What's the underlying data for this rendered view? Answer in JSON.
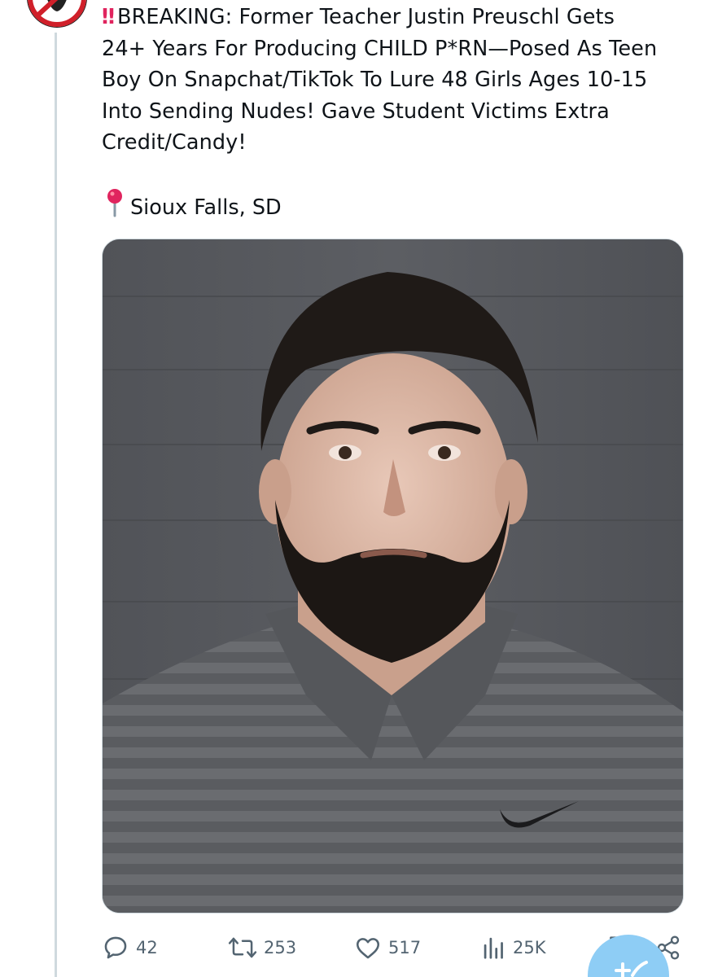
{
  "tweet": {
    "text_lines": [
      "BREAKING: Former Teacher Justin Preuschl Gets",
      "24+ Years For Producing CHILD P*RN—Posed As Teen",
      "Boy On Snapchat/TikTok To Lure 48 Girls Ages 10-15",
      "Into Sending Nudes! Gave Student Victims Extra",
      "Credit/Candy!"
    ],
    "lead_emoji": "‼",
    "location_icon": "round-pushpin-icon",
    "location": "Sioux Falls, SD",
    "image_alt": "Mugshot of a bearded man in a gray striped polo shirt"
  },
  "actions": {
    "replies": "42",
    "reposts": "253",
    "likes": "517",
    "views": "25K"
  },
  "icons": [
    "reply-icon",
    "repost-icon",
    "like-icon",
    "views-icon",
    "bookmark-icon",
    "share-icon",
    "compose-icon"
  ],
  "colors": {
    "text": "#0f1419",
    "muted": "#536471",
    "thread_line": "#cfd9de",
    "alert_red": "#e0245e",
    "fab_blue": "#1d9bf0"
  }
}
